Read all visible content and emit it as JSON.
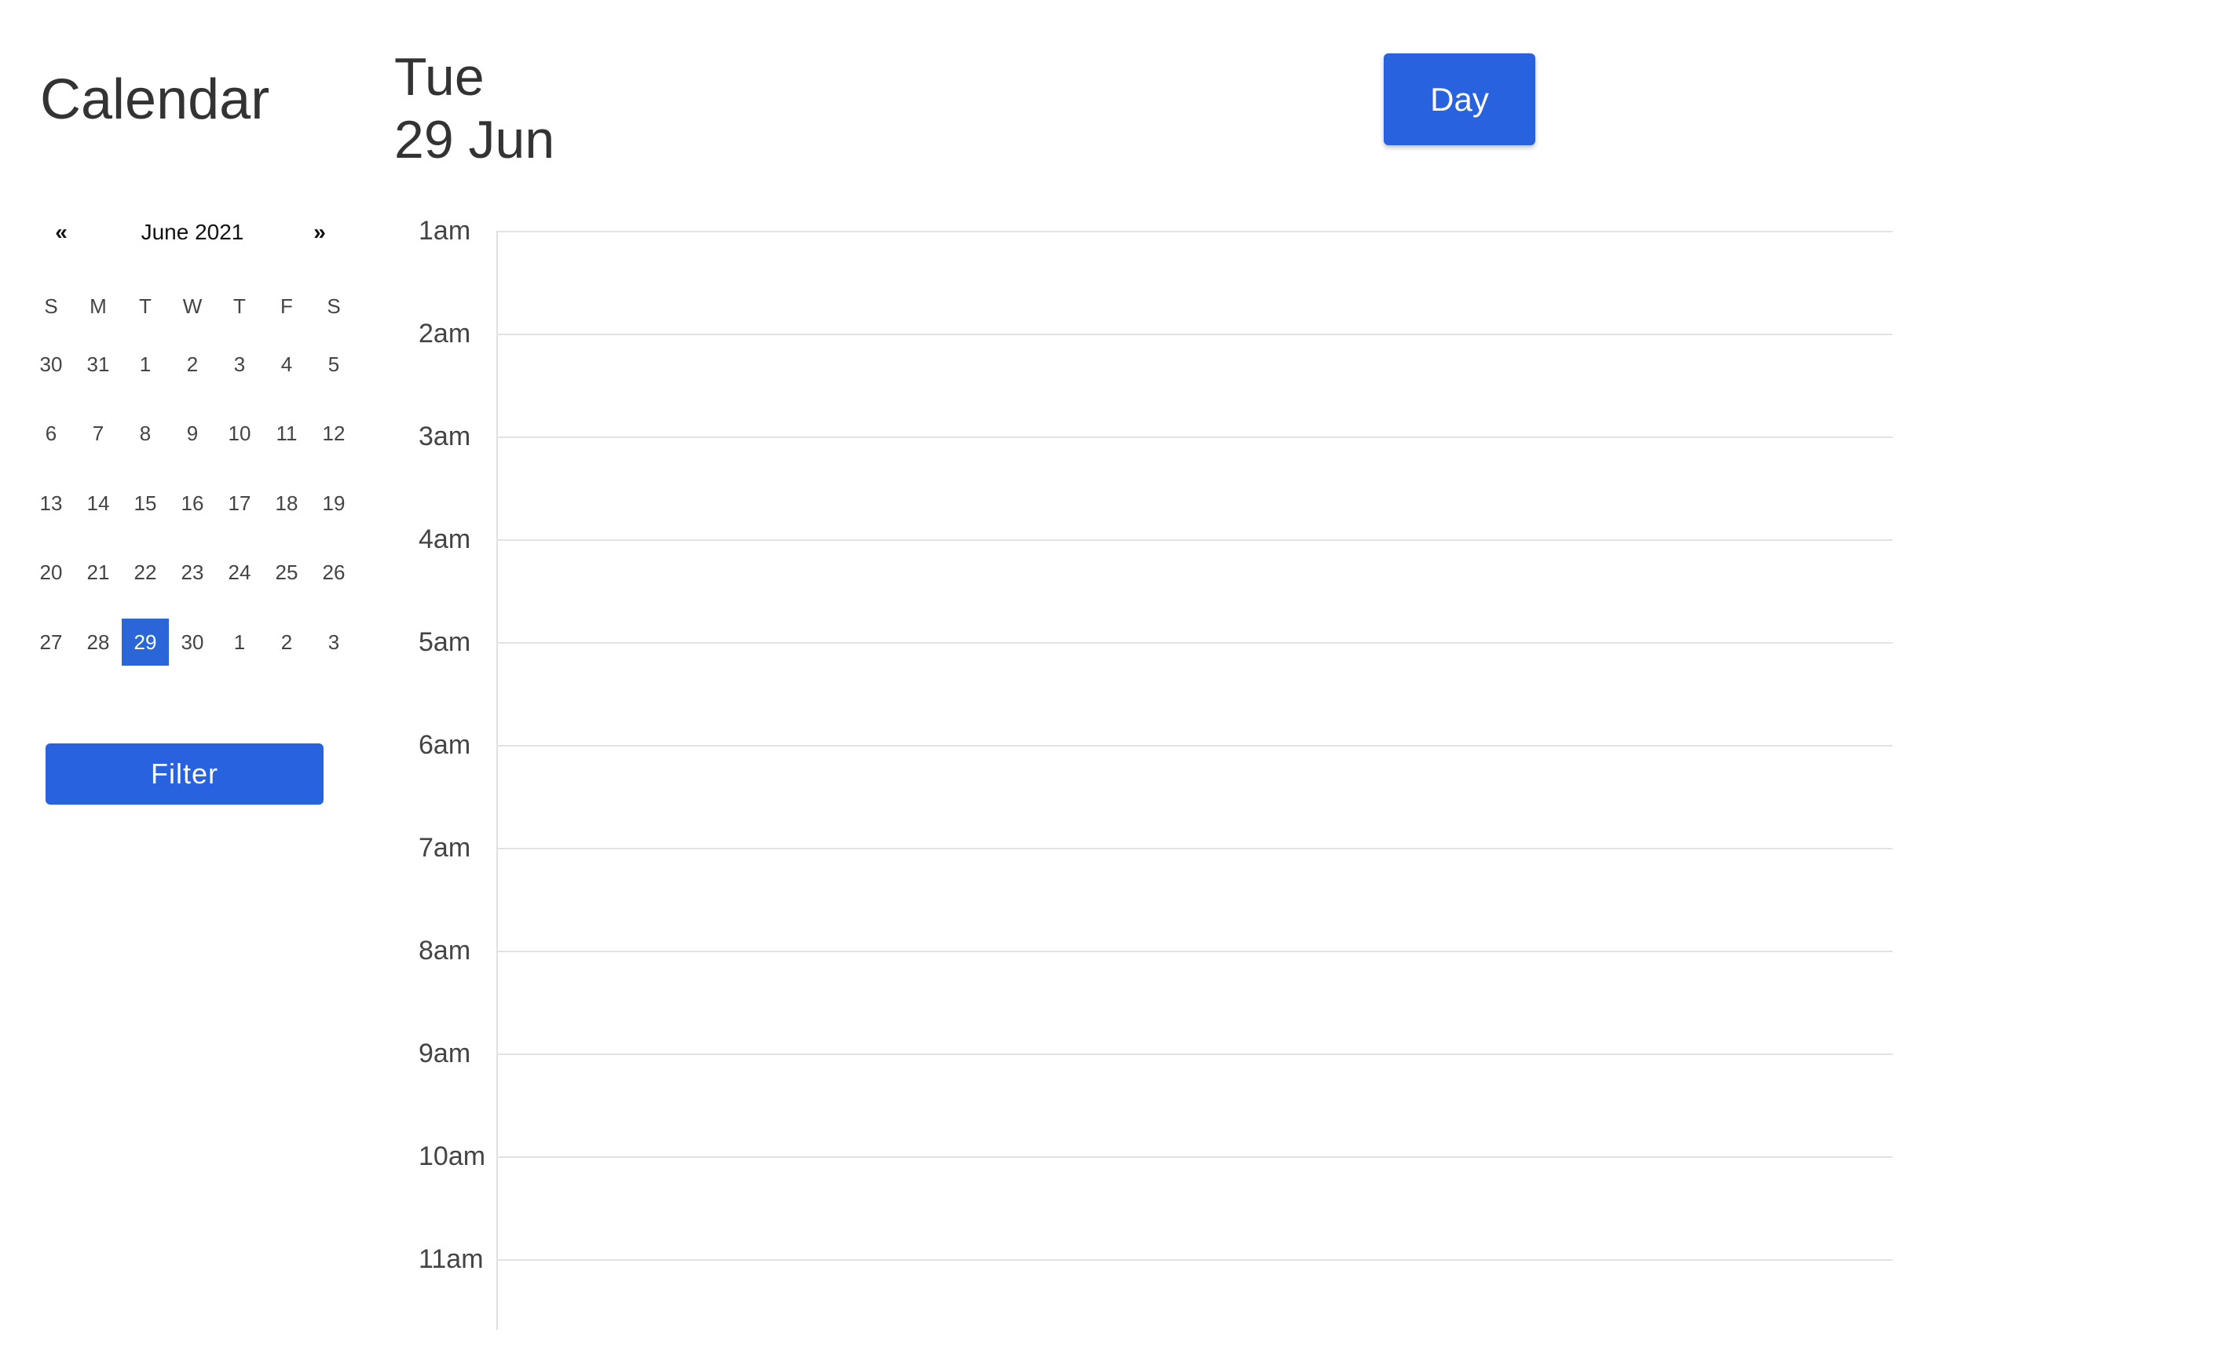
{
  "app": {
    "title": "Calendar"
  },
  "mini_calendar": {
    "prev_label": "«",
    "next_label": "»",
    "month_label": "June 2021",
    "weekdays": [
      "S",
      "M",
      "T",
      "W",
      "T",
      "F",
      "S"
    ],
    "weeks": [
      [
        "30",
        "31",
        "1",
        "2",
        "3",
        "4",
        "5"
      ],
      [
        "6",
        "7",
        "8",
        "9",
        "10",
        "11",
        "12"
      ],
      [
        "13",
        "14",
        "15",
        "16",
        "17",
        "18",
        "19"
      ],
      [
        "20",
        "21",
        "22",
        "23",
        "24",
        "25",
        "26"
      ],
      [
        "27",
        "28",
        "29",
        "30",
        "1",
        "2",
        "3"
      ]
    ],
    "selected_day": "29"
  },
  "filter": {
    "label": "Filter"
  },
  "day_header": {
    "weekday": "Tue",
    "date": "29 Jun"
  },
  "view": {
    "label": "Day"
  },
  "timeline": {
    "hours": [
      "1am",
      "2am",
      "3am",
      "4am",
      "5am",
      "6am",
      "7am",
      "8am",
      "9am",
      "10am",
      "11am"
    ]
  },
  "colors": {
    "accent": "#2962de",
    "selected_day": "#2b66d9",
    "text": "#333333",
    "grid_line": "#e3e3e3"
  }
}
